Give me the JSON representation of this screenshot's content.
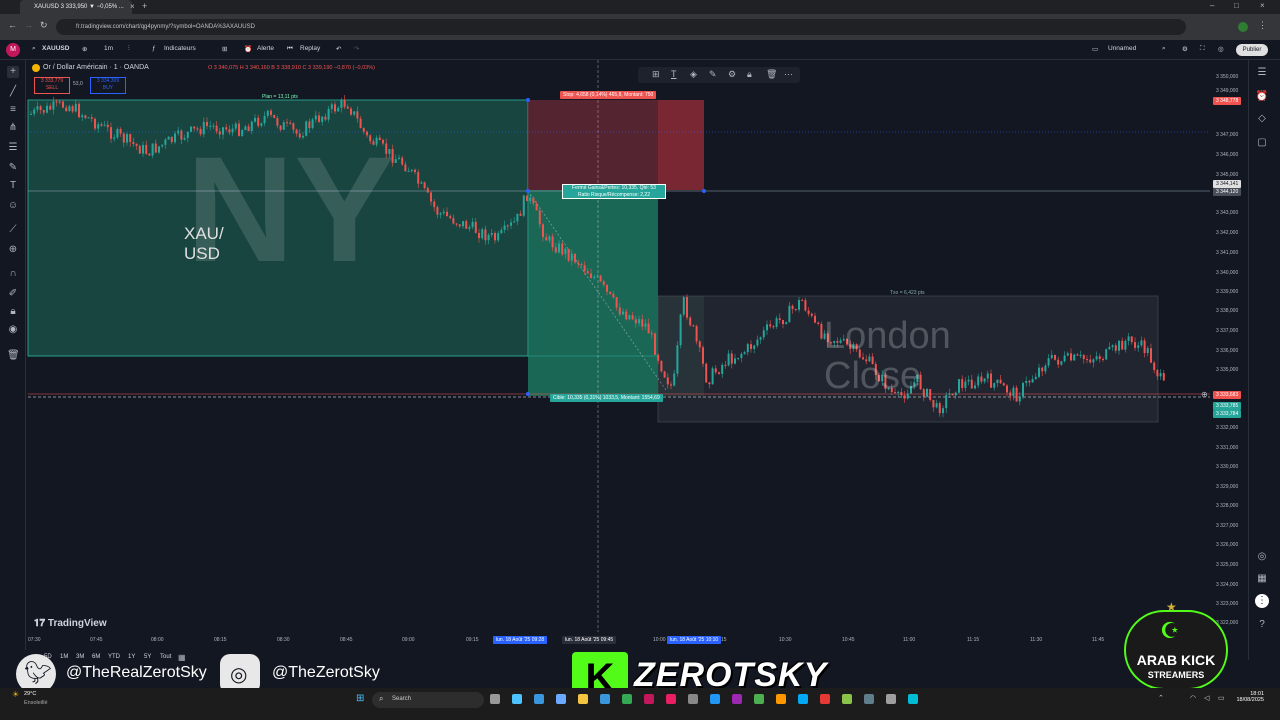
{
  "browser": {
    "tab_title": "XAUUSD 3 333,950 ▼ −0,05% ...",
    "url": "fr.tradingview.com/chart/qg4pynmy/?symbol=OANDA%3AXAUUSD"
  },
  "toolbar": {
    "symbol": "XAUUSD",
    "interval": "1m",
    "indicators": "Indicateurs",
    "alert": "Alerte",
    "replay": "Replay",
    "layout_name": "Unnamed",
    "publish": "Publier"
  },
  "legend": {
    "instrument": "Or / Dollar Américain · 1 · OANDA",
    "ohlc": "O 3 340,075  H 3 340,160  B 3 338,910  C 3 339,190  −0,870 (−0,03%)",
    "sell_price": "3 333,779",
    "sell_label": "SELL",
    "spread": "53,0",
    "buy_price": "3 334,309",
    "buy_label": "BUY"
  },
  "position": {
    "stop_label": "Stop: 4,658 (0,14%) 465,8, Montant: 750",
    "pnl_line1": "Fermé Gains&Pertes: 10,335, Qté: 53",
    "pnl_line2": "Ratio Risque/Récompense: 2,22",
    "target_label": "Cible: 10,335 (0,31%) 1033,5, Montant: 1554,69"
  },
  "boxes": {
    "ny_text": "NY",
    "ny_range": "Plan = 13,11 pts",
    "asset_text": "XAU/ USD",
    "london_text": "London Close",
    "london_range": "Txo = 6,423 pts"
  },
  "price_scale": [
    "3 350,000",
    "3 349,000",
    "3 347,000",
    "3 346,000",
    "3 345,000",
    "3 343,000",
    "3 342,000",
    "3 341,000",
    "3 340,000",
    "3 339,000",
    "3 338,000",
    "3 337,000",
    "3 336,000",
    "3 335,000",
    "3 333,000",
    "3 332,000",
    "3 331,000",
    "3 330,000",
    "3 329,000",
    "3 328,000",
    "3 327,000",
    "3 326,000",
    "3 325,000",
    "3 324,000",
    "3 323,000",
    "3 322,000"
  ],
  "price_tags": {
    "stop": "3 348,778",
    "entry": "3 344,141",
    "entry2": "3 344,120",
    "current": "3 333,683",
    "target": "3 333,785",
    "target2": "3 333,784"
  },
  "time_scale": [
    "07:30",
    "07:45",
    "08:00",
    "08:15",
    "08:30",
    "08:45",
    "09:00",
    "09:15",
    "09:30",
    "09:45",
    "10:00",
    "10:15",
    "10:30",
    "10:45",
    "11:00",
    "11:15",
    "11:30",
    "11:45"
  ],
  "time_tags": [
    "lun. 18 Août '25  09:28",
    "lun. 18 Août '25  09:45",
    "lun. 18 Août '25  10:10"
  ],
  "range_buttons": [
    "5D",
    "1M",
    "3M",
    "6M",
    "YTD",
    "1Y",
    "5Y",
    "Tout"
  ],
  "watermark": "TradingView",
  "overlay": {
    "twitter": "@TheRealZerotSky",
    "instagram": "@TheZerotSky",
    "brand": "ZEROTSKY",
    "logo_line1": "ARAB KICK",
    "logo_line2": "STREAMERS"
  },
  "taskbar": {
    "weather_temp": "29°C",
    "weather_desc": "Ensoleillé",
    "search": "Search",
    "time": "18:01",
    "date": "18/08/2025"
  },
  "colors": {
    "bg": "#131722",
    "up": "#26a69a",
    "down": "#ef5350",
    "target_zone": "#1f6b5a",
    "stop_zone": "#6b2a35"
  }
}
